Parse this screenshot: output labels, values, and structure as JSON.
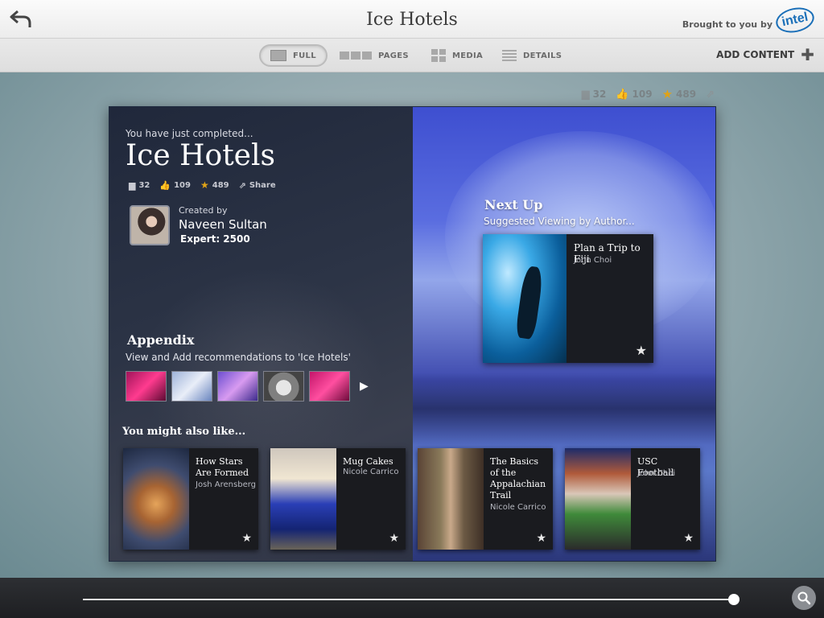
{
  "header": {
    "title": "Ice Hotels",
    "brought_by": "Brought to you by",
    "logo": "intel"
  },
  "viewbar": {
    "tabs": [
      {
        "label": "FULL",
        "icon": "full-view-icon",
        "active": true
      },
      {
        "label": "PAGES",
        "icon": "pages-view-icon"
      },
      {
        "label": "MEDIA",
        "icon": "media-view-icon"
      },
      {
        "label": "DETAILS",
        "icon": "details-view-icon"
      }
    ],
    "add_content": "ADD CONTENT"
  },
  "stats": {
    "comments": "32",
    "likes": "109",
    "stars": "489"
  },
  "left_page": {
    "completed": "You have just completed...",
    "title": "Ice Hotels",
    "share": "Share",
    "created_by": "Created by",
    "creator": "Naveen Sultan",
    "expert": "Expert: 2500",
    "appendix_title": "Appendix",
    "appendix_sub": "View and Add recommendations to 'Ice Hotels'",
    "might_like": "You might also like..."
  },
  "recommendations": [
    {
      "title": "How Stars Are Formed",
      "author": "Josh Arensberg"
    },
    {
      "title": "Mug Cakes",
      "author": "Nicole Carrico"
    },
    {
      "title": "The Basics of the Appalachian Trail",
      "author": "Nicole Carrico"
    },
    {
      "title": "USC Football",
      "author": "John Choi"
    }
  ],
  "next_up": {
    "title": "Next Up",
    "subtitle": "Suggested Viewing by Author...",
    "card_title": "Plan a Trip to Fiji",
    "card_author": "John Choi"
  },
  "colors": {
    "accent_star": "#e0a317",
    "intel_blue": "#1a6fb8"
  }
}
